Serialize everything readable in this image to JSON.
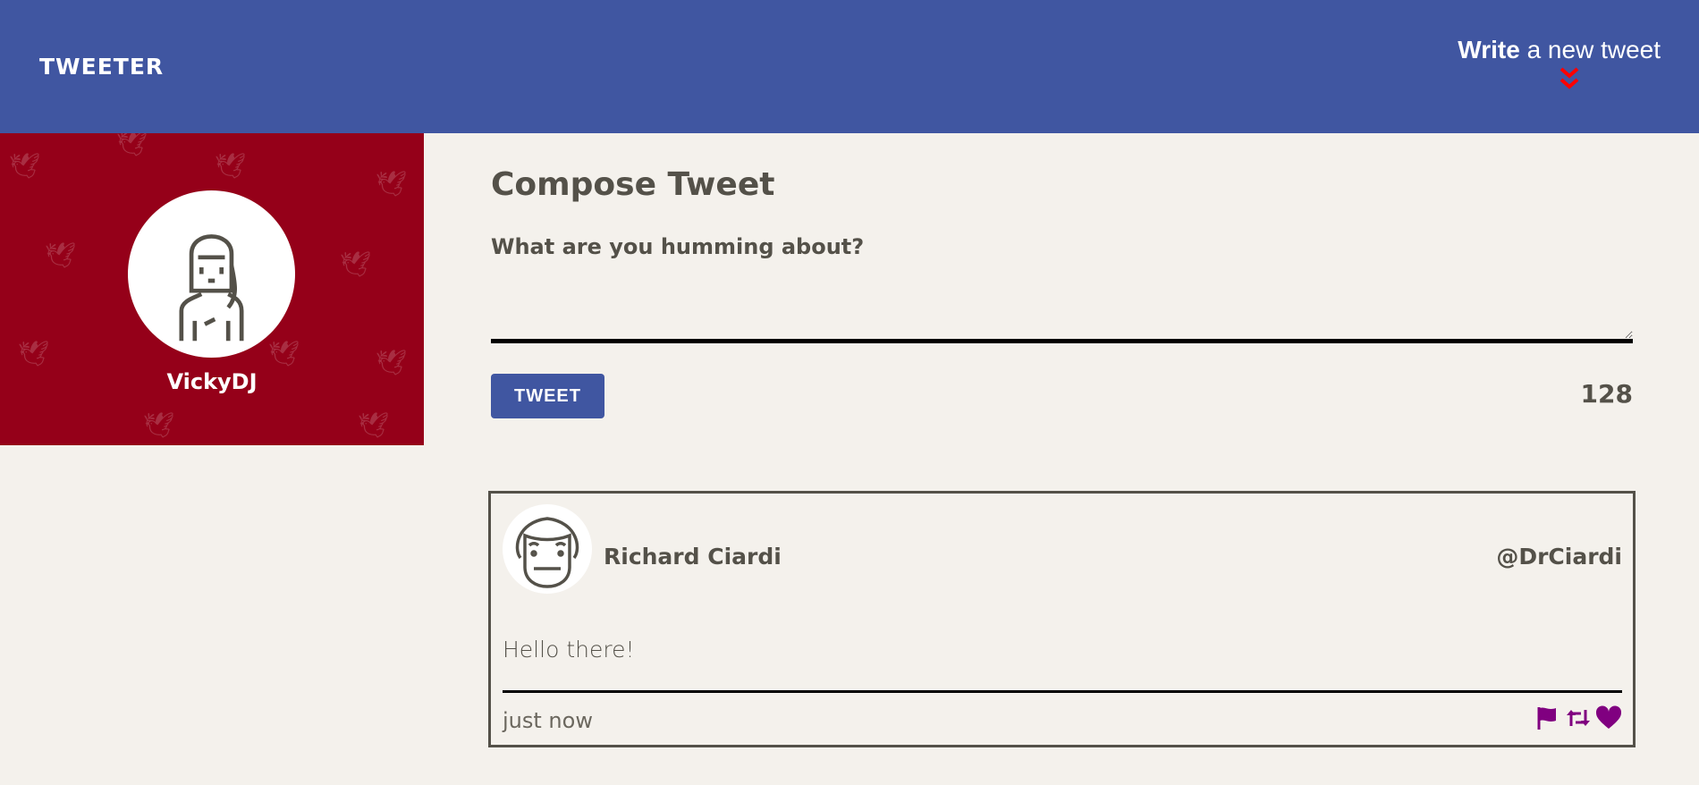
{
  "header": {
    "logo": "TWEETER",
    "write_bold": "Write",
    "write_rest": " a new tweet",
    "chevron_icon": "double-chevron-down",
    "chevron_color": "#ff0000"
  },
  "profile": {
    "username": "VickyDJ",
    "background_color": "#950019"
  },
  "compose": {
    "title": "Compose Tweet",
    "label": "What are you humming about?",
    "text": "",
    "tweet_button": "TWEET",
    "counter": "128"
  },
  "tweets": [
    {
      "name": "Richard Ciardi",
      "handle": "@DrCiardi",
      "content": "Hello there!",
      "time": "just now",
      "icons": [
        "flag-icon",
        "retweet-icon",
        "heart-icon"
      ],
      "icon_color": "#800080"
    }
  ],
  "colors": {
    "brand": "#4056a1",
    "page": "#f4f1ec",
    "text": "#545149"
  }
}
